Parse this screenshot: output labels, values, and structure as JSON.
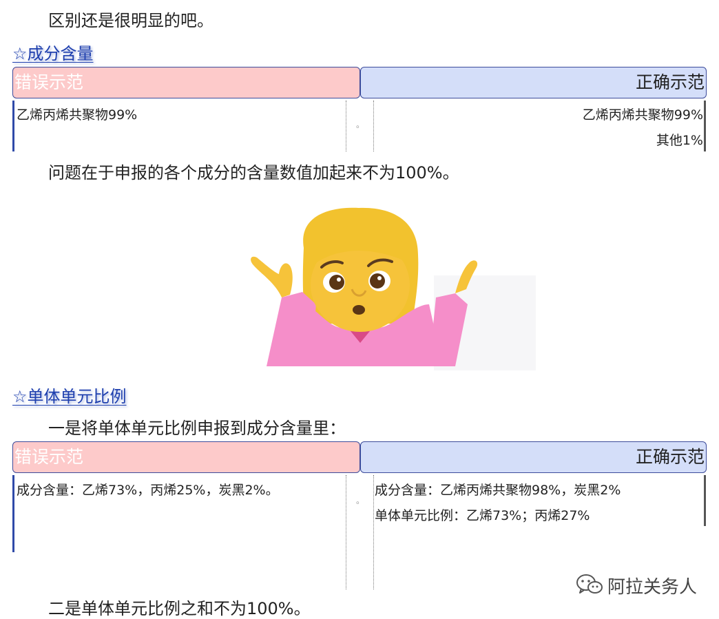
{
  "intro": "区别还是很明显的吧。",
  "section1": {
    "heading": "☆成分含量",
    "wrong_label": "错误示范",
    "right_label": "正确示范",
    "wrong_lines": [
      "乙烯丙烯共聚物99%"
    ],
    "right_lines": [
      "乙烯丙烯共聚物99%",
      "其他1%"
    ],
    "divider_mark": "。"
  },
  "note1": "问题在于申报的各个成分的含量数值加起来不为100%。",
  "section2": {
    "heading": "☆单体单元比例",
    "intro": "一是将单体单元比例申报到成分含量里：",
    "wrong_label": "错误示范",
    "right_label": "正确示范",
    "wrong_lines": [
      "成分含量：乙烯73%，丙烯25%，炭黑2%。"
    ],
    "right_lines": [
      "成分含量：乙烯丙烯共聚物98%，炭黑2%",
      "单体单元比例：乙烯73%；丙烯27%"
    ],
    "divider_mark": "。"
  },
  "note2": "二是单体单元比例之和不为100%。",
  "watermark": "阿拉关务人",
  "colors": {
    "heading": "#1e3fae",
    "wrong_bg": "#fdcaca",
    "right_bg": "#d4def9"
  }
}
